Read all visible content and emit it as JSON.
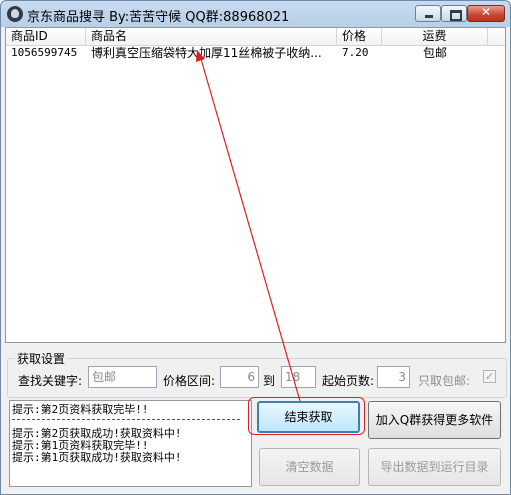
{
  "window": {
    "title": "京东商品搜寻 By:苦苦守候 QQ群:88968021",
    "controls": {
      "close_glyph": "✕"
    }
  },
  "listview": {
    "columns": [
      {
        "label": "商品ID"
      },
      {
        "label": "商品名"
      },
      {
        "label": "价格"
      },
      {
        "label": "运费"
      }
    ],
    "rows": [
      {
        "id": "1056599745",
        "name": "博利真空压缩袋特大加厚11丝棉被子收纳...",
        "price": "7.20",
        "shipping": "包邮"
      }
    ]
  },
  "settings": {
    "group_title": "获取设置",
    "keyword_label": "查找关键字:",
    "keyword_value": "包邮",
    "price_range_label": "价格区间:",
    "price_min": "6",
    "price_to_label": "到",
    "price_max": "18",
    "start_page_label": "起始页数:",
    "start_page_value": "3",
    "free_shipping_only_label": "只取包邮:",
    "free_shipping_only_checked": true,
    "check_glyph": "✓"
  },
  "log": {
    "lines": [
      "提示:第2页资料获取完毕!!",
      "提示:第2页获取成功!获取资料中!",
      "提示:第1页资料获取完毕!!",
      "提示:第1页获取成功!获取资料中!"
    ]
  },
  "buttons": {
    "stop_fetch": "结束获取",
    "join_qq_group": "加入Q群获得更多软件",
    "clear_data": "清空数据",
    "export_data": "导出数据到运行目录"
  },
  "colors": {
    "annotation_red": "#e02020",
    "title_bar": "#c7daf0"
  }
}
